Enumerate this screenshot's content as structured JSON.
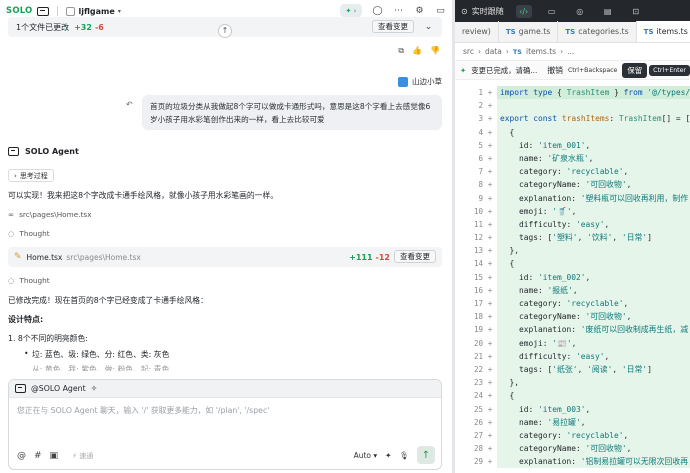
{
  "topbar": {
    "brand": "SOLO",
    "project": "ljflgame"
  },
  "change_summary": {
    "text": "1个文件已更改",
    "added": "+32",
    "removed": "-6",
    "view_button": "查看变更"
  },
  "user": {
    "name": "山边小草",
    "message": "首页的垃圾分类从我做起8个字可以做成卡通形式吗，意思是这8个字看上去感觉像6岁小孩子用水彩笔创作出来的一样，看上去比较可爱"
  },
  "agent": {
    "name": "SOLO Agent",
    "thinking_label": "思考过程",
    "reply": "可以实现！我来把这8个字改成卡通手绘风格，就像小孩子用水彩笔画的一样。",
    "file_ref": "src\\pages\\Home.tsx",
    "thought_label": "Thought",
    "file_card": {
      "name": "Home.tsx",
      "path": "src\\pages\\Home.tsx",
      "added": "+111",
      "removed": "-12",
      "view_button": "查看变更"
    },
    "done_text": "已修改完成！现在首页的8个字已经变成了卡通手绘风格：",
    "features_heading": "设计特点:",
    "numbered_item": "1. 8个不同的明亮颜色:",
    "bullet_item": "垃: 蓝色、圾: 绿色、分: 红色、类: 灰色",
    "bullet_item_faded": "从: 黄色、我: 紫色、做: 粉色、起: 青色"
  },
  "composer": {
    "mention": "@SOLO Agent",
    "placeholder": "您正在与 SOLO Agent 聊天，输入 '/' 获取更多能力，如 '/plan', '/spec'",
    "sub_label": "速通",
    "mode": "Auto"
  },
  "right_bar": {
    "follow_label": "实时跟随"
  },
  "editor": {
    "tabs": [
      {
        "label": "review)",
        "active": false,
        "ts": false
      },
      {
        "label": "game.ts",
        "active": false,
        "ts": true
      },
      {
        "label": "categories.ts",
        "active": false,
        "ts": true
      },
      {
        "label": "items.ts",
        "active": true,
        "ts": true
      }
    ],
    "breadcrumb": [
      "src",
      "data",
      "items.ts",
      "..."
    ],
    "diff_bar": {
      "status": "变更已完成，请确...",
      "undo": "撤销",
      "undo_key": "Ctrl+Backspace",
      "keep": "保留",
      "keep_key": "Ctrl+Enter"
    },
    "lines": [
      {
        "n": "1",
        "code": "import type { TrashItem } from '@/types/"
      },
      {
        "n": "2",
        "code": ""
      },
      {
        "n": "3",
        "code": "export const trashItems: TrashItem[] = ["
      },
      {
        "n": "4",
        "code": "  {"
      },
      {
        "n": "5",
        "code": "    id: 'item_001',"
      },
      {
        "n": "6",
        "code": "    name: '矿泉水瓶',"
      },
      {
        "n": "7",
        "code": "    category: 'recyclable',"
      },
      {
        "n": "8",
        "code": "    categoryName: '可回收物',"
      },
      {
        "n": "9",
        "code": "    explanation: '塑料瓶可以回收再利用，制作"
      },
      {
        "n": "10",
        "code": "    emoji: '🥤',"
      },
      {
        "n": "11",
        "code": "    difficulty: 'easy',"
      },
      {
        "n": "12",
        "code": "    tags: ['塑料', '饮料', '日常']"
      },
      {
        "n": "13",
        "code": "  },"
      },
      {
        "n": "14",
        "code": "  {"
      },
      {
        "n": "15",
        "code": "    id: 'item_002',"
      },
      {
        "n": "16",
        "code": "    name: '报纸',"
      },
      {
        "n": "17",
        "code": "    category: 'recyclable',"
      },
      {
        "n": "18",
        "code": "    categoryName: '可回收物',"
      },
      {
        "n": "19",
        "code": "    explanation: '废纸可以回收制成再生纸，减"
      },
      {
        "n": "20",
        "code": "    emoji: '📰',"
      },
      {
        "n": "21",
        "code": "    difficulty: 'easy',"
      },
      {
        "n": "22",
        "code": "    tags: ['纸张', '阅读', '日常']"
      },
      {
        "n": "23",
        "code": "  },"
      },
      {
        "n": "24",
        "code": "  {"
      },
      {
        "n": "25",
        "code": "    id: 'item_003',"
      },
      {
        "n": "26",
        "code": "    name: '易拉罐',"
      },
      {
        "n": "27",
        "code": "    category: 'recyclable',"
      },
      {
        "n": "28",
        "code": "    categoryName: '可回收物',"
      },
      {
        "n": "29",
        "code": "    explanation: '铝制易拉罐可以无限次回收再"
      }
    ]
  },
  "colors": {
    "brand_green": "#1a9f57",
    "removed_red": "#d24a3a",
    "diff_added_bg": "#e6f5ea",
    "dark_bar": "#24272c",
    "ts_blue": "#3178c6"
  }
}
